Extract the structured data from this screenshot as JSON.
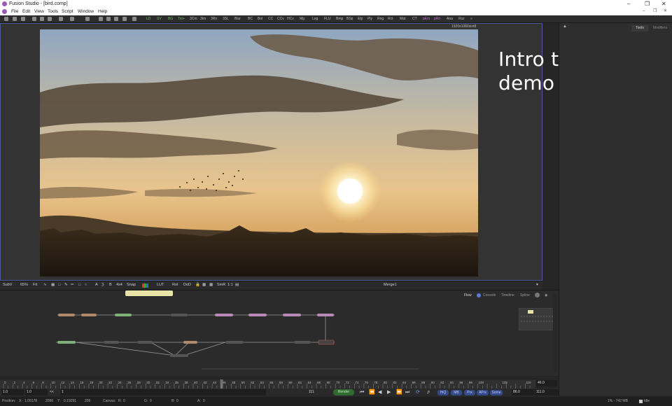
{
  "window": {
    "title": "Fusion Studio - [bird.comp]"
  },
  "menu": [
    "File",
    "Edit",
    "View",
    "Tools",
    "Script",
    "Window",
    "Help"
  ],
  "toolbar": {
    "buttons": [
      "LD",
      "SV",
      "BG",
      "Txt+",
      "3Cm",
      "3Im",
      "3Rn",
      "3SL",
      "Blur",
      "BC",
      "Bol",
      "CC",
      "CCv",
      "HCv",
      "Mg",
      "Log",
      "FLU",
      "Bmp",
      "BSp",
      "Elp",
      "Ply",
      "Rng",
      "Rct",
      "Mat",
      "CT",
      "pEm",
      "pRn",
      "Ana",
      "Rsz"
    ]
  },
  "viewer": {
    "resolution": "1920x1080xint8",
    "caption_line1": "Intro to fusion",
    "caption_line2": "demo files",
    "bar": {
      "subview": "SubV",
      "zoom": "65%",
      "fit": "Fit",
      "snap": "4x4",
      "snap_label": "Snap",
      "lut": "LUT",
      "roi": "RoI",
      "dod": "DoD",
      "smr": "SmR",
      "ratio": "1:1",
      "node_name": "Merge1"
    }
  },
  "right_panel": {
    "tabs": [
      "Tools",
      "Modifiers"
    ]
  },
  "flow": {
    "tabs": [
      "Flow",
      "Console",
      "Timeline",
      "Spline"
    ]
  },
  "timeline": {
    "ticks": [
      "0",
      "2",
      "4",
      "6",
      "8",
      "10",
      "12",
      "14",
      "16",
      "18",
      "20",
      "22",
      "24",
      "26",
      "28",
      "30",
      "32",
      "34",
      "36",
      "38",
      "40",
      "42",
      "44",
      "46",
      "48",
      "50",
      "52",
      "54",
      "56",
      "58",
      "60",
      "62",
      "64",
      "66",
      "68",
      "70",
      "72",
      "74",
      "76",
      "78",
      "80",
      "82",
      "84",
      "86",
      "88",
      "90",
      "92",
      "94",
      "96",
      "98",
      "100",
      "105",
      "110"
    ],
    "current_frame": "46.0",
    "global_start": "1.0",
    "render_start": "1.0",
    "step": "<<",
    "frame_field": "1",
    "render_end_field": "111",
    "render_label": "Render",
    "hiq": "HiQ",
    "mb": "MB",
    "prx": "Prx",
    "aprx": "APrx",
    "some": "Some",
    "step_fwd": ">>",
    "render_end": "86.0",
    "global_end": "111.0"
  },
  "status": {
    "position_label": "Position:",
    "x_label": "X:",
    "x_value": "1.09178",
    "x_px": "2096",
    "y_label": "Y:",
    "y_value": "0.19291",
    "y_px": "209",
    "canvas_label": "Canvas:",
    "r_label": "R:",
    "r_value": "0",
    "g_label": "G:",
    "g_value": "0",
    "b_label": "B:",
    "b_value": "0",
    "a_label": "A:",
    "a_value": "0",
    "memory": "1% - 742 MB",
    "state": "Idle"
  }
}
